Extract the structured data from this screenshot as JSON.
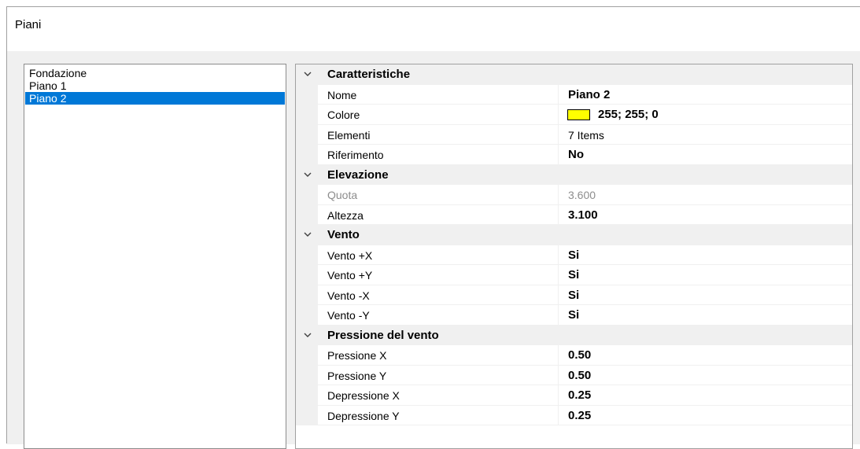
{
  "window": {
    "title": "Piani"
  },
  "list": {
    "items": [
      {
        "label": "Fondazione",
        "selected": false
      },
      {
        "label": "Piano 1",
        "selected": false
      },
      {
        "label": "Piano 2",
        "selected": true
      }
    ]
  },
  "grid": {
    "categories": [
      {
        "label": "Caratteristiche",
        "properties": [
          {
            "name": "Nome",
            "value": "Piano 2",
            "bold": true
          },
          {
            "name": "Colore",
            "value": "255; 255; 0",
            "bold": true,
            "swatch": "#ffff00"
          },
          {
            "name": "Elementi",
            "value": "7 Items",
            "bold": false
          },
          {
            "name": "Riferimento",
            "value": "No",
            "bold": true
          }
        ]
      },
      {
        "label": "Elevazione",
        "properties": [
          {
            "name": "Quota",
            "value": "3.600",
            "bold": false,
            "disabled": true
          },
          {
            "name": "Altezza",
            "value": "3.100",
            "bold": true
          }
        ]
      },
      {
        "label": "Vento",
        "properties": [
          {
            "name": "Vento +X",
            "value": "Si",
            "bold": true
          },
          {
            "name": "Vento +Y",
            "value": "Si",
            "bold": true
          },
          {
            "name": "Vento -X",
            "value": "Si",
            "bold": true
          },
          {
            "name": "Vento -Y",
            "value": "Si",
            "bold": true
          }
        ]
      },
      {
        "label": "Pressione del vento",
        "properties": [
          {
            "name": "Pressione X",
            "value": "0.50",
            "bold": true
          },
          {
            "name": "Pressione Y",
            "value": "0.50",
            "bold": true
          },
          {
            "name": "Depressione X",
            "value": "0.25",
            "bold": true
          },
          {
            "name": "Depressione Y",
            "value": "0.25",
            "bold": true
          }
        ]
      }
    ]
  },
  "colors": {
    "selection": "#0078d7",
    "category_bg": "#f0f0f0",
    "swatch": "#ffff00"
  },
  "icons": {
    "expanded": "chevron-down-icon"
  }
}
